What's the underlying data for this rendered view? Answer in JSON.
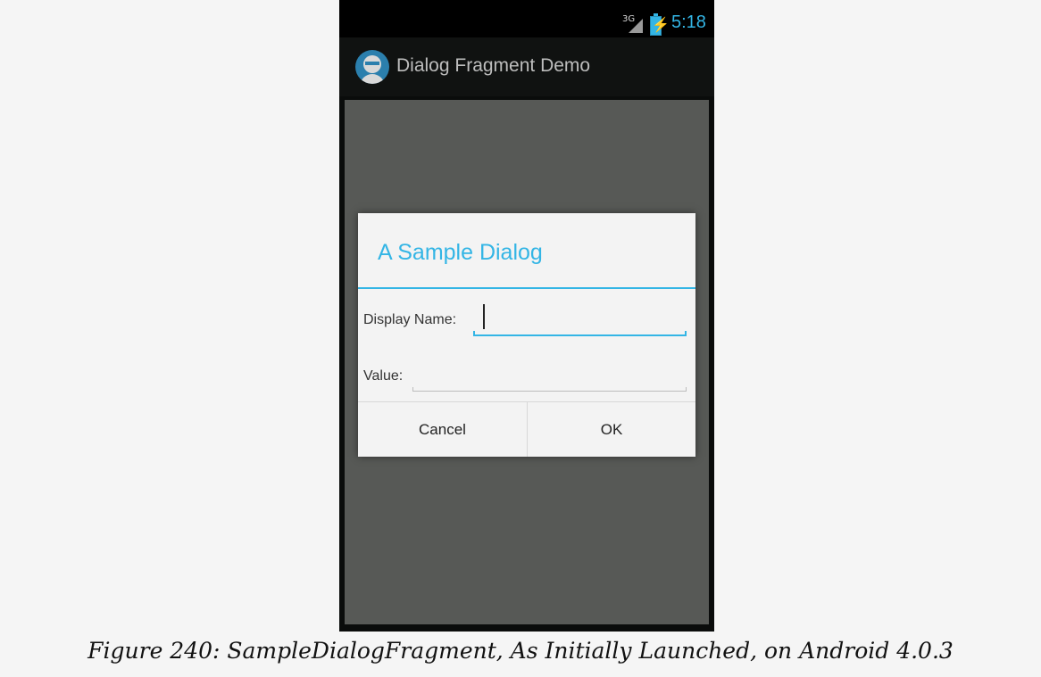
{
  "status_bar": {
    "network": "3G",
    "time": "5:18",
    "signal_icon": "signal-icon",
    "battery_icon": "battery-charging-icon"
  },
  "action_bar": {
    "icon": "app-avatar-icon",
    "title": "Dialog Fragment Demo"
  },
  "dialog": {
    "title": "A Sample Dialog",
    "fields": {
      "display_name_label": "Display Name:",
      "display_name_value": "",
      "value_label": "Value:",
      "value_value": ""
    },
    "buttons": {
      "cancel": "Cancel",
      "ok": "OK"
    }
  },
  "caption": "Figure 240: SampleDialogFragment, As Initially Launched, on Android 4.0.3",
  "colors": {
    "accent": "#33b5e5",
    "screen_dim": "#575956",
    "dialog_bg": "#f3f3f3",
    "page_bg": "#f5f5f5"
  }
}
